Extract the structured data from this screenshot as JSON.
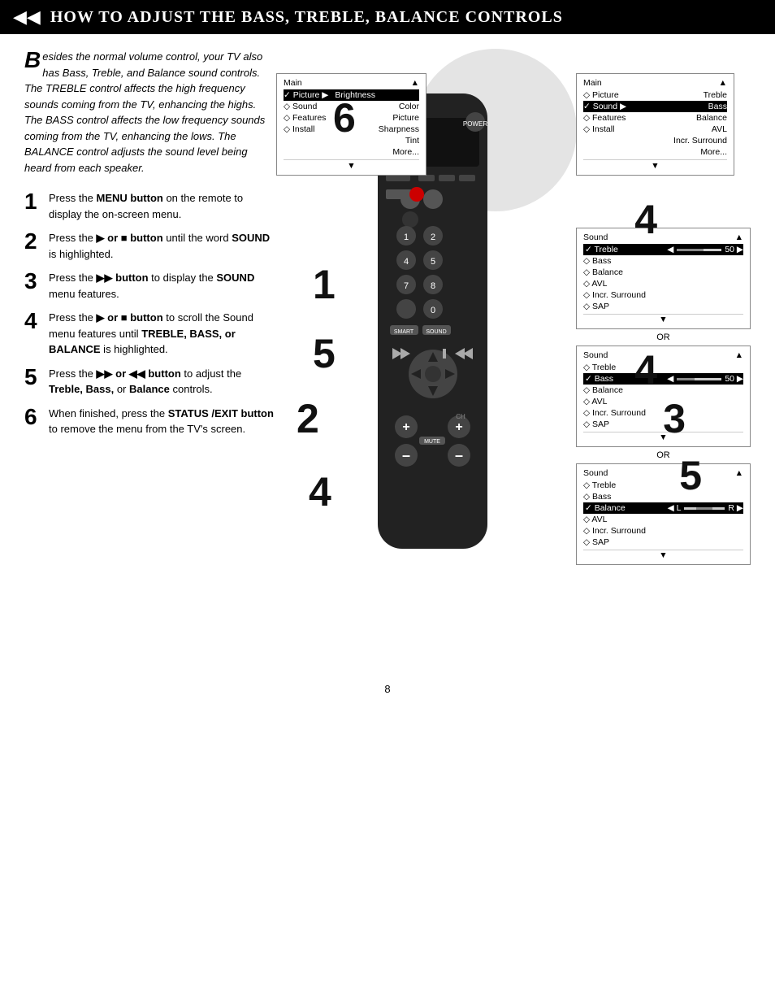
{
  "header": {
    "title": "How to Adjust the Bass, Treble, Balance Controls",
    "icon": "◀◀"
  },
  "intro": {
    "dropcap": "B",
    "text": "esides the normal volume control, your TV also has Bass, Treble, and Balance sound controls. The TREBLE control affects the high frequency sounds coming from the TV, enhancing the highs. The BASS control affects the low frequency sounds coming from the TV, enhancing the lows. The BALANCE control adjusts the sound level being heard from each speaker."
  },
  "steps": [
    {
      "number": "1",
      "text": "Press the MENU button on the remote to display the on-screen menu."
    },
    {
      "number": "2",
      "text": "Press the ▶ or ■ button until the word SOUND is highlighted."
    },
    {
      "number": "3",
      "text": "Press the ▶▶ button to display the SOUND menu features."
    },
    {
      "number": "4",
      "text": "Press the ▶ or ■ button to scroll the Sound menu features until TREBLE, BASS, or BALANCE is highlighted."
    },
    {
      "number": "5",
      "text": "Press the ▶▶ or ◀◀ button to adjust the Treble, Bass, or Balance controls."
    },
    {
      "number": "6",
      "text": "When finished, press the STATUS/EXIT button to remove the menu from the TV's screen."
    }
  ],
  "menu_main": {
    "header": "Main",
    "arrow": "▲",
    "rows": [
      {
        "label": "✓ Picture",
        "arrow": "▶",
        "right": "Brightness"
      },
      {
        "label": "◇ Sound",
        "right": "Color"
      },
      {
        "label": "◇ Features",
        "right": "Picture"
      },
      {
        "label": "◇ Install",
        "right": "Sharpness"
      },
      {
        "label": "",
        "right": "Tint"
      },
      {
        "label": "",
        "right": "More..."
      }
    ],
    "footer": "▼"
  },
  "menu_main2": {
    "header": "Main",
    "arrow": "▲",
    "rows": [
      {
        "label": "◇ Picture",
        "right": "Treble"
      },
      {
        "label": "✓ Sound",
        "arrow": "▶",
        "right": "Bass"
      },
      {
        "label": "◇ Features",
        "right": "Balance"
      },
      {
        "label": "◇ Install",
        "right": "AVL"
      },
      {
        "label": "",
        "right": "Incr. Surround"
      },
      {
        "label": "",
        "right": "More..."
      }
    ],
    "footer": "▼"
  },
  "menu_sound_treble": {
    "title": "Sound",
    "arrow": "▲",
    "rows": [
      {
        "label": "✓ Treble",
        "selected": true,
        "slider": "50"
      },
      {
        "label": "◇ Bass"
      },
      {
        "label": "◇ Balance"
      },
      {
        "label": "◇ AVL"
      },
      {
        "label": "◇ Incr. Surround"
      },
      {
        "label": "◇ SAP"
      }
    ],
    "footer": "▼"
  },
  "menu_sound_bass": {
    "title": "Sound",
    "arrow": "▲",
    "rows": [
      {
        "label": "◇ Treble"
      },
      {
        "label": "✓ Bass",
        "selected": true,
        "slider": "50"
      },
      {
        "label": "◇ Balance"
      },
      {
        "label": "◇ AVL"
      },
      {
        "label": "◇ Incr. Surround"
      },
      {
        "label": "◇ SAP"
      }
    ],
    "footer": "▼"
  },
  "menu_sound_balance": {
    "title": "Sound",
    "arrow": "▲",
    "rows": [
      {
        "label": "◇ Treble"
      },
      {
        "label": "◇ Bass"
      },
      {
        "label": "✓ Balance",
        "selected": true,
        "slider_balance": true
      },
      {
        "label": "◇ AVL"
      },
      {
        "label": "◇ Incr. Surround"
      },
      {
        "label": "◇ SAP"
      }
    ],
    "footer": "▼"
  },
  "page_number": "8",
  "or_text": "OR",
  "step_numbers_diagram": [
    "6",
    "4",
    "1",
    "5",
    "2",
    "4",
    "3",
    "5"
  ]
}
